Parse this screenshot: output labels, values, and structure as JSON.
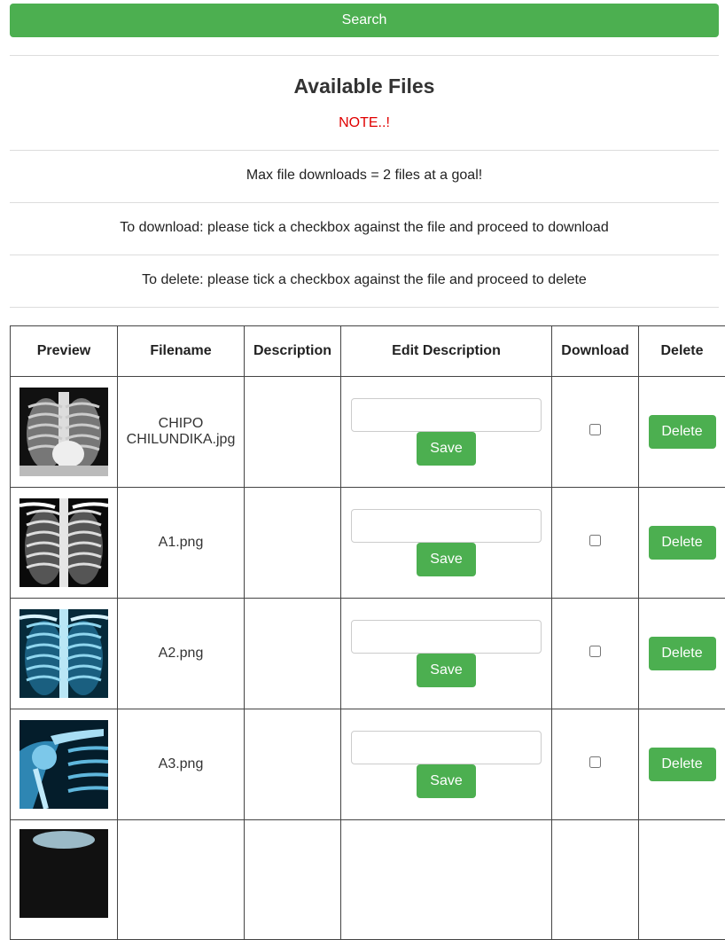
{
  "search": {
    "label": "Search"
  },
  "heading": "Available Files",
  "note": "NOTE..!",
  "info": {
    "max_downloads": "Max file downloads = 2 files at a goal!",
    "to_download": "To download: please tick a checkbox against the file and proceed to download",
    "to_delete": "To delete: please tick a checkbox against the file and proceed to delete"
  },
  "table": {
    "headers": [
      "Preview",
      "Filename",
      "Description",
      "Edit Description",
      "Download",
      "Delete"
    ],
    "rows": [
      {
        "filename": "CHIPO CHILUNDIKA.jpg",
        "description": "",
        "edit_value": "",
        "save_label": "Save",
        "download_checked": false,
        "delete_label": "Delete",
        "preview_icon": "chest-xray-gray"
      },
      {
        "filename": "A1.png",
        "description": "",
        "edit_value": "",
        "save_label": "Save",
        "download_checked": false,
        "delete_label": "Delete",
        "preview_icon": "chest-xray-gray"
      },
      {
        "filename": "A2.png",
        "description": "",
        "edit_value": "",
        "save_label": "Save",
        "download_checked": false,
        "delete_label": "Delete",
        "preview_icon": "chest-xray-blue"
      },
      {
        "filename": "A3.png",
        "description": "",
        "edit_value": "",
        "save_label": "Save",
        "download_checked": false,
        "delete_label": "Delete",
        "preview_icon": "shoulder-xray-blue"
      }
    ]
  },
  "colors": {
    "accent": "#4caf50",
    "note": "#e00000"
  }
}
